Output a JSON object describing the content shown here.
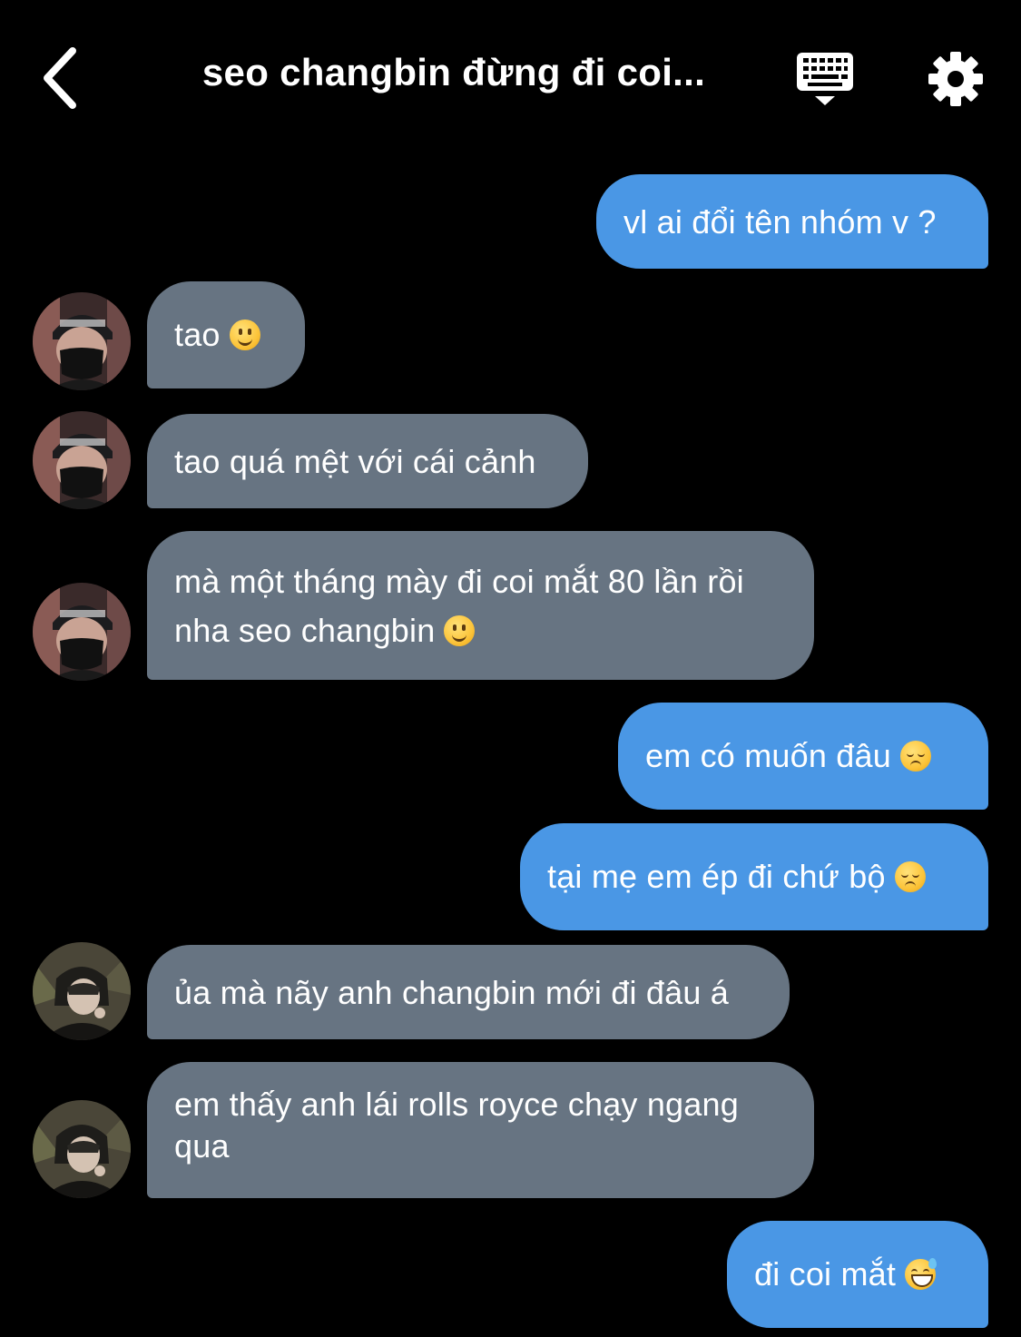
{
  "header": {
    "title": "seo changbin đừng đi coi...",
    "back_icon": "chevron-left-icon",
    "keyboard_icon": "keyboard-icon",
    "settings_icon": "gear-icon"
  },
  "colors": {
    "background": "#000000",
    "outgoing_bubble": "#4a97e5",
    "incoming_bubble": "#677482",
    "text": "#ffffff"
  },
  "messages": [
    {
      "sender": "me",
      "text": "vl ai đổi tên nhóm v ?"
    },
    {
      "sender": "them",
      "text": "tao",
      "emoji": "slightly-smiling-face"
    },
    {
      "sender": "them",
      "text": "tao quá mệt với cái cảnh"
    },
    {
      "sender": "them",
      "text": "mà một tháng mày đi coi mắt 80 lần rồi nha seo changbin",
      "emoji": "slightly-smiling-face"
    },
    {
      "sender": "me",
      "text": "em có muốn đâu",
      "emoji": "pensive-face"
    },
    {
      "sender": "me",
      "text": "tại mẹ em ép đi chứ bộ",
      "emoji": "pensive-face"
    },
    {
      "sender": "them",
      "text": "ủa mà nãy anh changbin mới đi đâu á"
    },
    {
      "sender": "them",
      "text": "em thấy anh lái rolls royce chạy ngang qua"
    },
    {
      "sender": "me",
      "text": "đi coi mắt",
      "emoji": "grinning-face-with-sweat"
    }
  ]
}
